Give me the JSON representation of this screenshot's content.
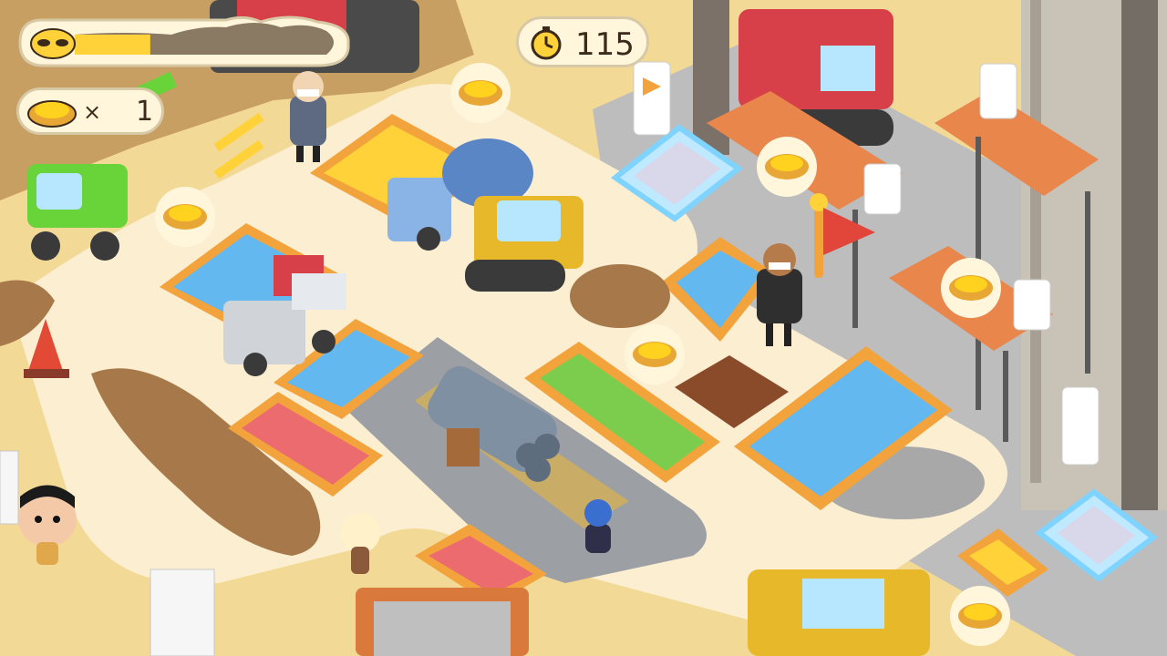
{
  "hud": {
    "timer": {
      "icon": "stopwatch-icon",
      "value": "115"
    },
    "collected": {
      "icon": "tart-icon",
      "multiplier": "×",
      "value": "1"
    },
    "progress": {
      "icon": "mask-icon",
      "fill_fraction": 0.3
    }
  },
  "colors": {
    "ground": "#f3d996",
    "path": "#fbeed1",
    "pad_blue": "#62b8ef",
    "pad_red": "#ec6b6f",
    "pad_green": "#7ccd4e",
    "pad_yellow": "#ffd23a",
    "pad_border": "#f2a33c",
    "crane_green": "#69d43a",
    "crane_red": "#d74049",
    "excavator_yellow": "#e7b92a",
    "truck_blue": "#8ab3e6",
    "scaffold_orange": "#e8864b",
    "concrete_floor": "#cfcfcf"
  },
  "scene": {
    "collectibles": [
      "tart-icon",
      "tart-icon",
      "tart-icon",
      "tart-icon",
      "tart-icon",
      "tart-icon",
      "tart-icon"
    ],
    "characters": [
      "player-character",
      "worker-helmet",
      "worker-mask-1",
      "worker-mask-2",
      "bear-worker"
    ]
  }
}
